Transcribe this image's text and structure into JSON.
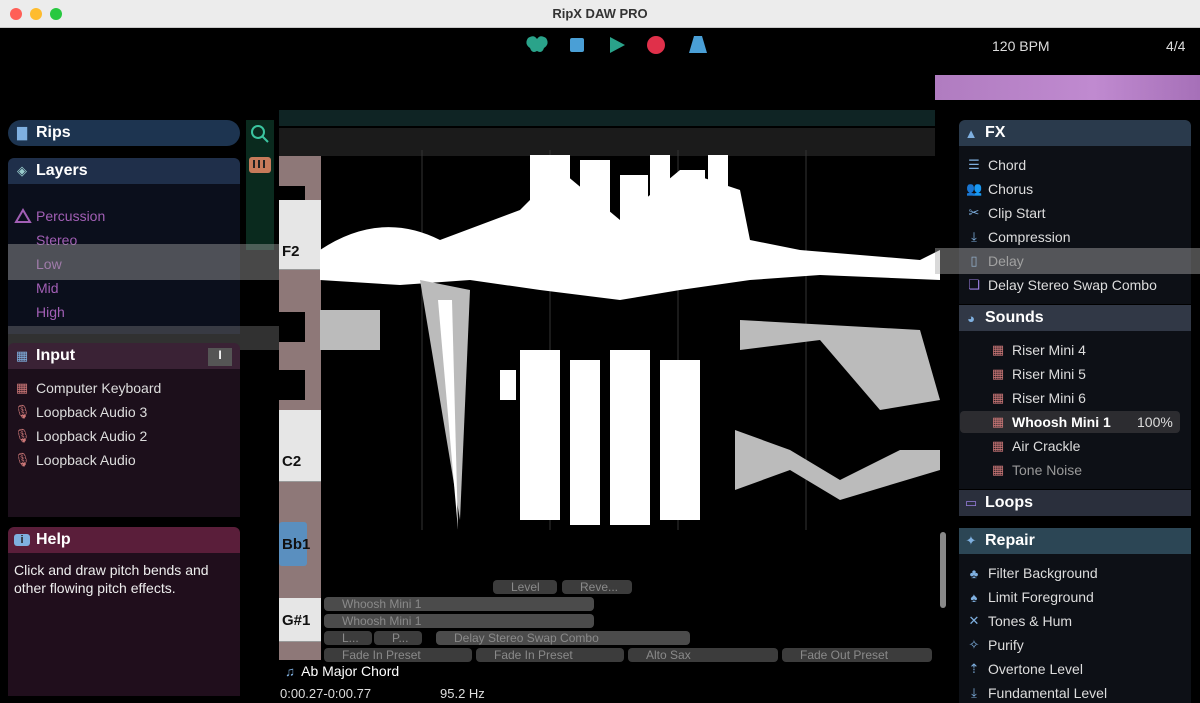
{
  "window": {
    "title": "RipX DAW PRO"
  },
  "transport": {
    "bpm": "120 BPM",
    "time_signature": "4/4"
  },
  "left": {
    "rips_label": "Rips",
    "layers_label": "Layers",
    "layers": [
      "Percussion",
      "Stereo",
      "Low",
      "Mid",
      "High"
    ],
    "input_label": "Input",
    "inputs": [
      "Computer Keyboard",
      "Loopback Audio 3",
      "Loopback Audio 2",
      "Loopback Audio"
    ],
    "help_label": "Help",
    "help_text": "Click and draw pitch bends and other flowing pitch effects."
  },
  "editor": {
    "keys": [
      "F2",
      "C2",
      "Bb1",
      "G#1"
    ],
    "clips": {
      "level": "Level",
      "reverb": "Reve...",
      "whoosh1": "Whoosh Mini 1",
      "whoosh2": "Whoosh Mini 1",
      "c1": "L...",
      "c2": "P...",
      "delay_combo": "Delay Stereo Swap Combo",
      "fade_in1": "Fade In Preset",
      "fade_in2": "Fade In Preset",
      "alto_sax": "Alto Sax",
      "fade_out": "Fade Out Preset"
    },
    "chord": "Ab Major Chord",
    "time": "0:00.27-0:00.77",
    "frequency": "95.2 Hz"
  },
  "right": {
    "fx_label": "FX",
    "fx": [
      "Chord",
      "Chorus",
      "Clip Start",
      "Compression",
      "Delay",
      "Delay Stereo Swap Combo"
    ],
    "sounds_label": "Sounds",
    "sounds": [
      "Riser Mini 4",
      "Riser Mini 5",
      "Riser Mini 6",
      "Whoosh Mini 1",
      "Air Crackle",
      "Tone Noise"
    ],
    "selected_percent": "100%",
    "loops_label": "Loops",
    "repair_label": "Repair",
    "repair": [
      "Filter Background",
      "Limit Foreground",
      "Tones & Hum",
      "Purify",
      "Overtone Level",
      "Fundamental Level"
    ]
  },
  "colors": {
    "accent_green": "#2aa38a",
    "record_red": "#e0304a",
    "accent_blue": "#4a9fd6"
  }
}
